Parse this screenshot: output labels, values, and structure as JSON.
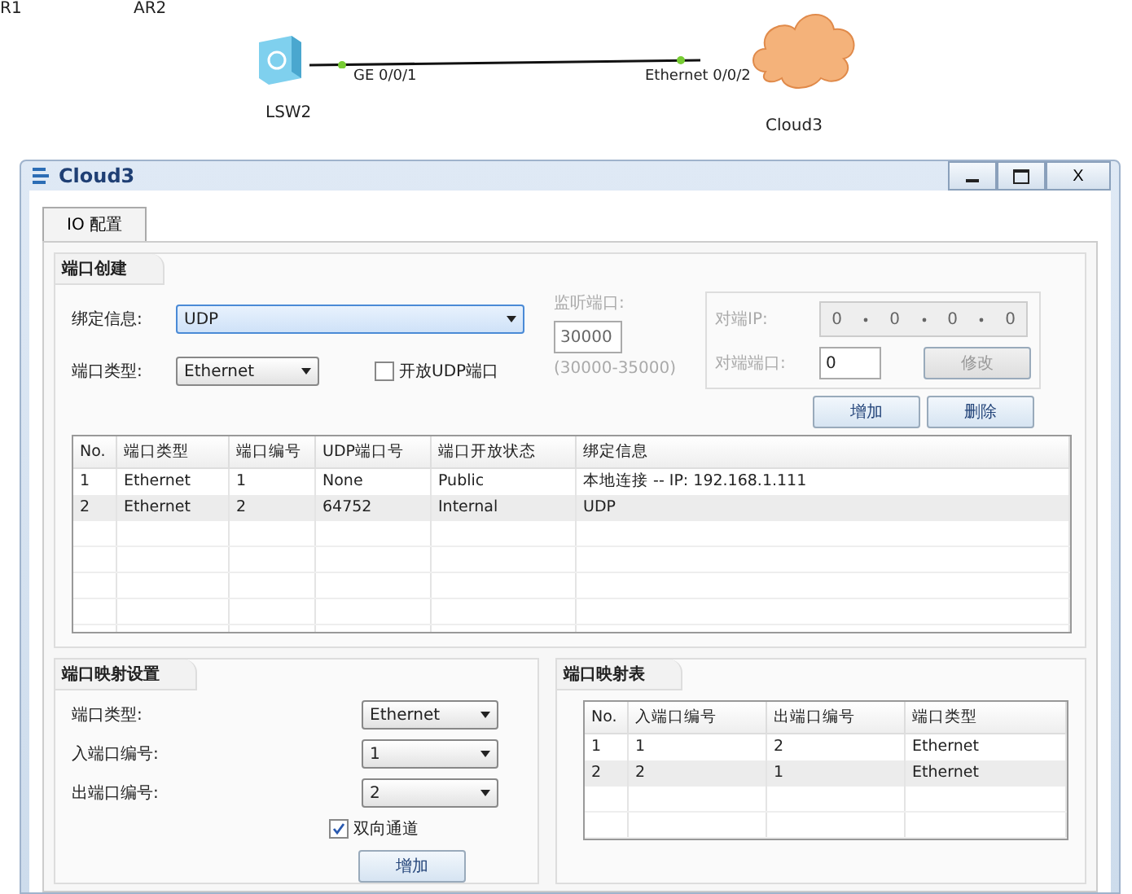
{
  "topology": {
    "labels": [
      "R1",
      "AR2"
    ],
    "devices": [
      {
        "name": "LSW2",
        "kind": "switch"
      },
      {
        "name": "Cloud3",
        "kind": "cloud"
      }
    ],
    "link": {
      "ports": [
        "GE 0/0/1",
        "Ethernet 0/0/2"
      ]
    }
  },
  "window": {
    "title": "Cloud3",
    "close": "X"
  },
  "tabs": [
    {
      "label": "IO 配置",
      "selected": true
    }
  ],
  "port_creation": {
    "title": "端口创建",
    "binding": {
      "label": "绑定信息:",
      "value": "UDP"
    },
    "port_type": {
      "label": "端口类型:",
      "value": "Ethernet"
    },
    "open_udp": {
      "label": "开放UDP端口",
      "checked": false
    },
    "listen": {
      "label": "监听端口:",
      "value": "30000",
      "hint": "(30000-35000)",
      "disabled": true
    },
    "peer": {
      "disabled": true,
      "ip_label": "对端IP:",
      "octets": [
        "0",
        "0",
        "0",
        "0"
      ],
      "port_label": "对端端口:",
      "port_value": "0",
      "modify": "修改"
    },
    "buttons": [
      "增加",
      "删除"
    ],
    "table": {
      "columns": [
        "No.",
        "端口类型",
        "端口编号",
        "UDP端口号",
        "端口开放状态",
        "绑定信息"
      ],
      "rows": [
        [
          "1",
          "Ethernet",
          "1",
          "None",
          "Public",
          "本地连接 -- IP: 192.168.1.111"
        ],
        [
          "2",
          "Ethernet",
          "2",
          "64752",
          "Internal",
          "UDP"
        ]
      ]
    }
  },
  "mapping_settings": {
    "title": "端口映射设置",
    "fields": [
      {
        "label": "端口类型:",
        "value": "Ethernet"
      },
      {
        "label": "入端口编号:",
        "value": "1"
      },
      {
        "label": "出端口编号:",
        "value": "2"
      }
    ],
    "bidirectional": {
      "label": "双向通道",
      "checked": true
    },
    "button": "增加"
  },
  "mapping_table": {
    "title": "端口映射表",
    "columns": [
      "No.",
      "入端口编号",
      "出端口编号",
      "端口类型"
    ],
    "rows": [
      [
        "1",
        "1",
        "2",
        "Ethernet"
      ],
      [
        "2",
        "2",
        "1",
        "Ethernet"
      ]
    ]
  }
}
